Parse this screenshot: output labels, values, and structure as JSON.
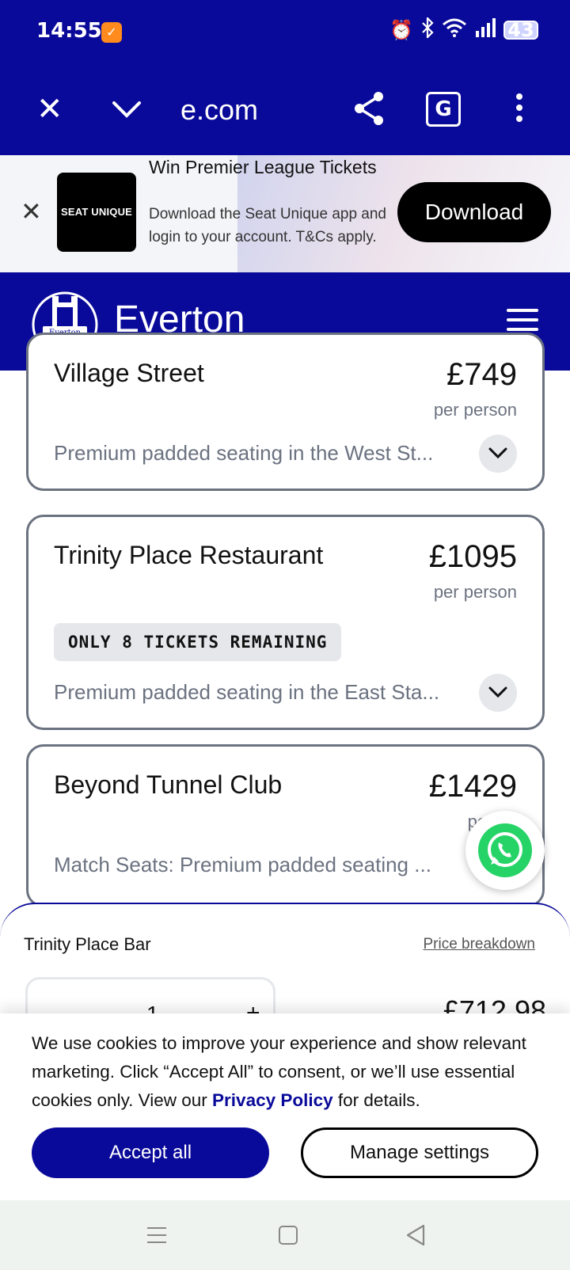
{
  "status_bar": {
    "time": "14:55",
    "app_icon": "orange-app-icon",
    "icons": [
      "alarm-icon",
      "bluetooth-icon",
      "wifi-icon",
      "signal-icon"
    ],
    "battery": "43"
  },
  "browser": {
    "url": "e.com",
    "icons": [
      "close-icon",
      "chevron-down-icon",
      "share-icon",
      "translate-icon",
      "more-vert-icon"
    ]
  },
  "promo": {
    "logo_text": "SEAT UNIQUE",
    "title": "Win Premier League Tickets",
    "description": "Download the Seat Unique app and login to your account. T&Cs apply.",
    "button": "Download"
  },
  "site": {
    "title": "Everton",
    "crest_text": "Everton"
  },
  "cards": [
    {
      "title": "Village Street",
      "price": "£749",
      "per": "per person",
      "description": "Premium padded seating in the West St..."
    },
    {
      "title": "Trinity Place Restaurant",
      "price": "£1095",
      "per": "per person",
      "badge": "ONLY 8 TICKETS REMAINING",
      "description": "Premium padded seating in the East Sta..."
    },
    {
      "title": "Beyond Tunnel Club",
      "price": "£1429",
      "per": "per pe",
      "description": "Match Seats: Premium padded seating ..."
    }
  ],
  "sheet": {
    "title": "Trinity Place Bar",
    "link": "Price breakdown",
    "quantity": "1",
    "plus": "+",
    "total": "£712.98"
  },
  "cookie": {
    "text_before": "We use cookies to improve your experience and show relevant marketing. Click “Accept All” to consent, or we’ll use essential cookies only. View our ",
    "link": "Privacy Policy",
    "text_after": " for details.",
    "accept": "Accept all",
    "manage": "Manage settings"
  },
  "colors": {
    "brand_blue": "#0a0a9a",
    "whatsapp_green": "#25d366",
    "muted_text": "#6b7280"
  }
}
